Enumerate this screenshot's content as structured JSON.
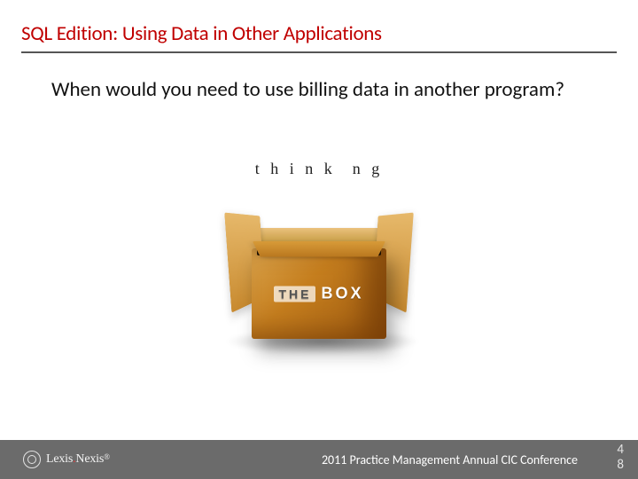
{
  "title": "SQL Edition: Using Data in Other Applications",
  "body": "When would you need to use billing data in another program?",
  "image": {
    "letters_prefix": "t h i n k",
    "letters_suffix": "n g",
    "box_label_small": "THE",
    "box_label_big": "BOX"
  },
  "footer": {
    "brand": "LexisNexis",
    "brand_prefix": "Lexis",
    "brand_suffix": "Nexis",
    "caption": "2011 Practice Management Annual CIC Conference",
    "page_a": "4",
    "page_b": "8"
  }
}
